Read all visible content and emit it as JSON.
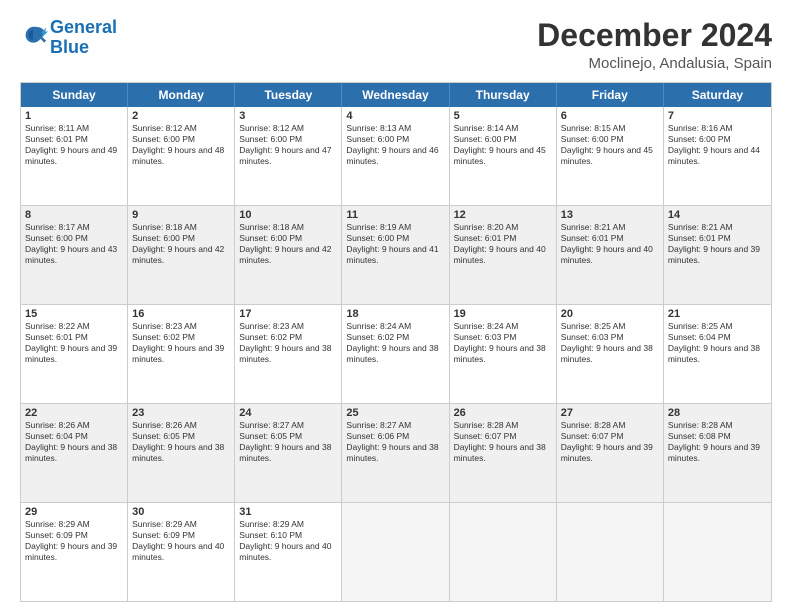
{
  "logo": {
    "line1": "General",
    "line2": "Blue"
  },
  "header": {
    "month": "December 2024",
    "location": "Moclinejo, Andalusia, Spain"
  },
  "weekdays": [
    "Sunday",
    "Monday",
    "Tuesday",
    "Wednesday",
    "Thursday",
    "Friday",
    "Saturday"
  ],
  "weeks": [
    [
      {
        "day": "1",
        "sunrise": "8:11 AM",
        "sunset": "6:01 PM",
        "daylight": "9 hours and 49 minutes."
      },
      {
        "day": "2",
        "sunrise": "8:12 AM",
        "sunset": "6:00 PM",
        "daylight": "9 hours and 48 minutes."
      },
      {
        "day": "3",
        "sunrise": "8:12 AM",
        "sunset": "6:00 PM",
        "daylight": "9 hours and 47 minutes."
      },
      {
        "day": "4",
        "sunrise": "8:13 AM",
        "sunset": "6:00 PM",
        "daylight": "9 hours and 46 minutes."
      },
      {
        "day": "5",
        "sunrise": "8:14 AM",
        "sunset": "6:00 PM",
        "daylight": "9 hours and 45 minutes."
      },
      {
        "day": "6",
        "sunrise": "8:15 AM",
        "sunset": "6:00 PM",
        "daylight": "9 hours and 45 minutes."
      },
      {
        "day": "7",
        "sunrise": "8:16 AM",
        "sunset": "6:00 PM",
        "daylight": "9 hours and 44 minutes."
      }
    ],
    [
      {
        "day": "8",
        "sunrise": "8:17 AM",
        "sunset": "6:00 PM",
        "daylight": "9 hours and 43 minutes."
      },
      {
        "day": "9",
        "sunrise": "8:18 AM",
        "sunset": "6:00 PM",
        "daylight": "9 hours and 42 minutes."
      },
      {
        "day": "10",
        "sunrise": "8:18 AM",
        "sunset": "6:00 PM",
        "daylight": "9 hours and 42 minutes."
      },
      {
        "day": "11",
        "sunrise": "8:19 AM",
        "sunset": "6:00 PM",
        "daylight": "9 hours and 41 minutes."
      },
      {
        "day": "12",
        "sunrise": "8:20 AM",
        "sunset": "6:01 PM",
        "daylight": "9 hours and 40 minutes."
      },
      {
        "day": "13",
        "sunrise": "8:21 AM",
        "sunset": "6:01 PM",
        "daylight": "9 hours and 40 minutes."
      },
      {
        "day": "14",
        "sunrise": "8:21 AM",
        "sunset": "6:01 PM",
        "daylight": "9 hours and 39 minutes."
      }
    ],
    [
      {
        "day": "15",
        "sunrise": "8:22 AM",
        "sunset": "6:01 PM",
        "daylight": "9 hours and 39 minutes."
      },
      {
        "day": "16",
        "sunrise": "8:23 AM",
        "sunset": "6:02 PM",
        "daylight": "9 hours and 39 minutes."
      },
      {
        "day": "17",
        "sunrise": "8:23 AM",
        "sunset": "6:02 PM",
        "daylight": "9 hours and 38 minutes."
      },
      {
        "day": "18",
        "sunrise": "8:24 AM",
        "sunset": "6:02 PM",
        "daylight": "9 hours and 38 minutes."
      },
      {
        "day": "19",
        "sunrise": "8:24 AM",
        "sunset": "6:03 PM",
        "daylight": "9 hours and 38 minutes."
      },
      {
        "day": "20",
        "sunrise": "8:25 AM",
        "sunset": "6:03 PM",
        "daylight": "9 hours and 38 minutes."
      },
      {
        "day": "21",
        "sunrise": "8:25 AM",
        "sunset": "6:04 PM",
        "daylight": "9 hours and 38 minutes."
      }
    ],
    [
      {
        "day": "22",
        "sunrise": "8:26 AM",
        "sunset": "6:04 PM",
        "daylight": "9 hours and 38 minutes."
      },
      {
        "day": "23",
        "sunrise": "8:26 AM",
        "sunset": "6:05 PM",
        "daylight": "9 hours and 38 minutes."
      },
      {
        "day": "24",
        "sunrise": "8:27 AM",
        "sunset": "6:05 PM",
        "daylight": "9 hours and 38 minutes."
      },
      {
        "day": "25",
        "sunrise": "8:27 AM",
        "sunset": "6:06 PM",
        "daylight": "9 hours and 38 minutes."
      },
      {
        "day": "26",
        "sunrise": "8:28 AM",
        "sunset": "6:07 PM",
        "daylight": "9 hours and 38 minutes."
      },
      {
        "day": "27",
        "sunrise": "8:28 AM",
        "sunset": "6:07 PM",
        "daylight": "9 hours and 39 minutes."
      },
      {
        "day": "28",
        "sunrise": "8:28 AM",
        "sunset": "6:08 PM",
        "daylight": "9 hours and 39 minutes."
      }
    ],
    [
      {
        "day": "29",
        "sunrise": "8:29 AM",
        "sunset": "6:09 PM",
        "daylight": "9 hours and 39 minutes."
      },
      {
        "day": "30",
        "sunrise": "8:29 AM",
        "sunset": "6:09 PM",
        "daylight": "9 hours and 40 minutes."
      },
      {
        "day": "31",
        "sunrise": "8:29 AM",
        "sunset": "6:10 PM",
        "daylight": "9 hours and 40 minutes."
      },
      null,
      null,
      null,
      null
    ]
  ]
}
